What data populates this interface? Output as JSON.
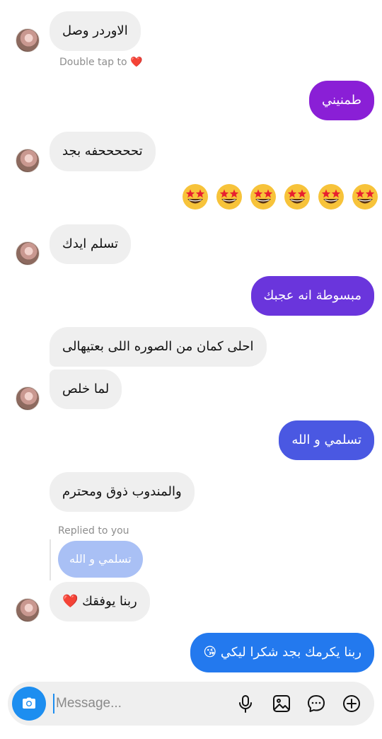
{
  "messages": [
    {
      "text": "الاوردر وصل"
    },
    {
      "text": "طمنيني"
    },
    {
      "text": "تحححححفه بجد"
    },
    {
      "text": "تسلم ايدك"
    },
    {
      "text": "مبسوطة انه عجبك"
    },
    {
      "text": "احلى كمان من الصوره اللى بعتيهالى"
    },
    {
      "text": "لما خلص"
    },
    {
      "text": "تسلمي و الله"
    },
    {
      "text": "والمندوب ذوق ومحترم"
    },
    {
      "text": "تسلمي و الله"
    },
    {
      "text": "ربنا يوفقك ❤️"
    },
    {
      "text": "ربنا يكرمك بجد شكرا ليكي 😘"
    }
  ],
  "double_tap_hint": "Double tap to ❤️",
  "replied_label": "Replied to you",
  "emoji_message": {
    "emoji": "star-struck",
    "count": 6
  },
  "composer": {
    "placeholder": "Message..."
  },
  "colors": {
    "outgoing": [
      "#8a1fd6",
      "#6a35dc",
      "#4a58e2",
      "#2379ee"
    ],
    "incoming": "#efefef",
    "reply_quote": "#a9c0f5"
  }
}
